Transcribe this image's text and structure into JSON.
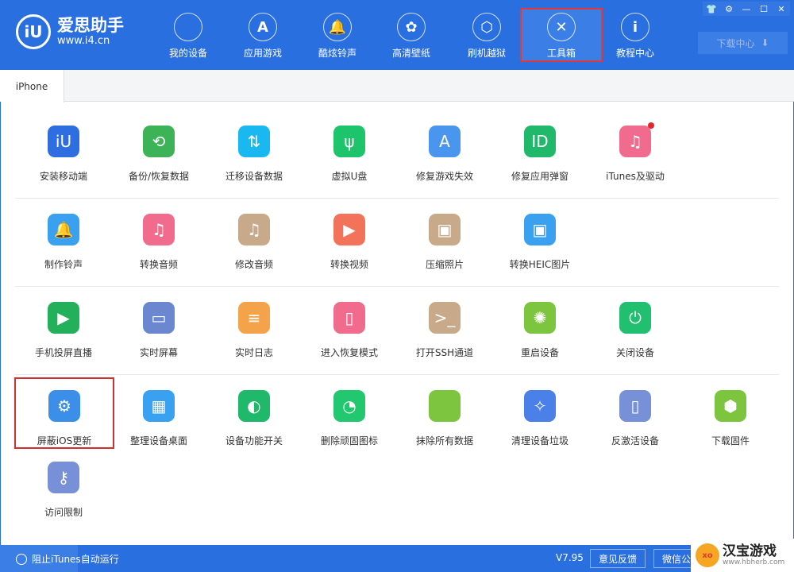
{
  "app": {
    "name": "爱思助手",
    "url": "www.i4.cn"
  },
  "nav": [
    {
      "label": "我的设备",
      "icon": "apple-icon",
      "glyph": ""
    },
    {
      "label": "应用游戏",
      "icon": "app-store-icon",
      "glyph": "A"
    },
    {
      "label": "酷炫铃声",
      "icon": "bell-icon",
      "glyph": "🔔"
    },
    {
      "label": "高清壁纸",
      "icon": "flower-icon",
      "glyph": "✿"
    },
    {
      "label": "刷机越狱",
      "icon": "box-icon",
      "glyph": "⬡"
    },
    {
      "label": "工具箱",
      "icon": "tools-icon",
      "glyph": "✕",
      "active": true
    },
    {
      "label": "教程中心",
      "icon": "info-icon",
      "glyph": "i"
    }
  ],
  "window_controls": [
    "shirt-icon",
    "gear-icon",
    "minimize-icon",
    "maximize-icon",
    "close-icon"
  ],
  "download_center": "下载中心",
  "tab": "iPhone",
  "tools": [
    [
      {
        "label": "安装移动端",
        "color": "#2f6ee0",
        "glyph": "iU"
      },
      {
        "label": "备份/恢复数据",
        "color": "#3db357",
        "glyph": "⟲"
      },
      {
        "label": "迁移设备数据",
        "color": "#1ab8f0",
        "glyph": "⇅"
      },
      {
        "label": "虚拟U盘",
        "color": "#1ec46b",
        "glyph": "ψ"
      },
      {
        "label": "修复游戏失效",
        "color": "#4a95ee",
        "glyph": "A"
      },
      {
        "label": "修复应用弹窗",
        "color": "#20b86a",
        "glyph": "ID"
      },
      {
        "label": "iTunes及驱动",
        "color": "#f06b8e",
        "glyph": "♫",
        "badge": true
      }
    ],
    [
      {
        "label": "制作铃声",
        "color": "#3aa0f0",
        "glyph": "🔔"
      },
      {
        "label": "转换音频",
        "color": "#f06b8e",
        "glyph": "♫"
      },
      {
        "label": "修改音频",
        "color": "#c8a98a",
        "glyph": "♫"
      },
      {
        "label": "转换视频",
        "color": "#f2735a",
        "glyph": "▶"
      },
      {
        "label": "压缩照片",
        "color": "#c8a98a",
        "glyph": "▣"
      },
      {
        "label": "转换HEIC图片",
        "color": "#3aa0f0",
        "glyph": "▣"
      }
    ],
    [
      {
        "label": "手机投屏直播",
        "color": "#22b05a",
        "glyph": "▶"
      },
      {
        "label": "实时屏幕",
        "color": "#6b87d0",
        "glyph": "▭"
      },
      {
        "label": "实时日志",
        "color": "#f5a34a",
        "glyph": "≡"
      },
      {
        "label": "进入恢复模式",
        "color": "#f06b8e",
        "glyph": "▯"
      },
      {
        "label": "打开SSH通道",
        "color": "#c8a98a",
        "glyph": ">_"
      },
      {
        "label": "重启设备",
        "color": "#7dc53e",
        "glyph": "✺"
      },
      {
        "label": "关闭设备",
        "color": "#20c070",
        "glyph": "⏻"
      }
    ],
    [
      {
        "label": "屏蔽iOS更新",
        "color": "#3c8fe8",
        "glyph": "⚙",
        "highlight": true
      },
      {
        "label": "整理设备桌面",
        "color": "#3aa0f0",
        "glyph": "▦"
      },
      {
        "label": "设备功能开关",
        "color": "#20b86a",
        "glyph": "◐"
      },
      {
        "label": "删除顽固图标",
        "color": "#22c870",
        "glyph": "◔"
      },
      {
        "label": "抹除所有数据",
        "color": "#7dc53e",
        "glyph": ""
      },
      {
        "label": "清理设备垃圾",
        "color": "#4a80e8",
        "glyph": "✧"
      },
      {
        "label": "反激活设备",
        "color": "#7890d8",
        "glyph": "▯"
      },
      {
        "label": "下载固件",
        "color": "#7dc53e",
        "glyph": "⬢"
      }
    ],
    [
      {
        "label": "访问限制",
        "color": "#7890d8",
        "glyph": "⚷"
      }
    ]
  ],
  "footer": {
    "itunes_block": "阻止iTunes自动运行",
    "version": "V7.95",
    "feedback": "意见反馈",
    "wechat": "微信公众号"
  },
  "watermark": {
    "name": "汉宝游戏",
    "url": "www.hbherb.com"
  },
  "colors": {
    "brand": "#2a6fe0",
    "highlight_border": "#d32f2f"
  }
}
